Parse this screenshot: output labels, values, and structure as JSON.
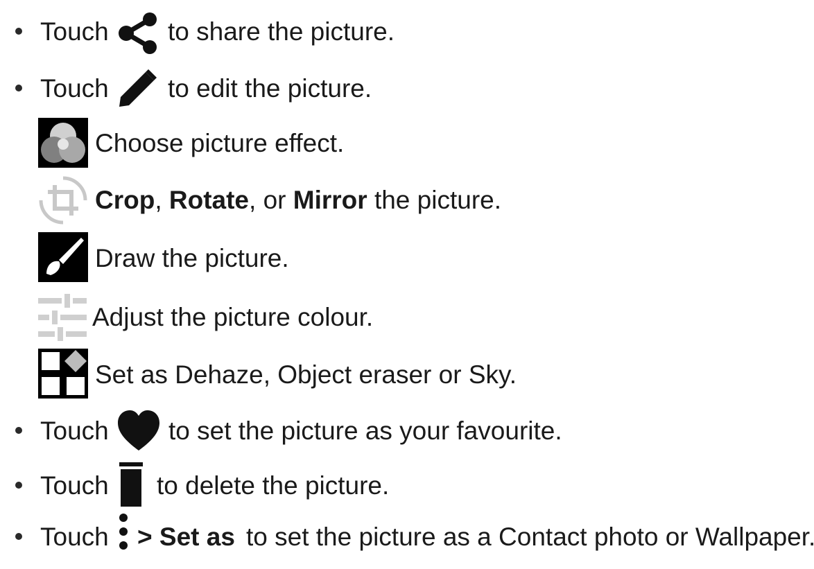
{
  "items": [
    {
      "prefix": "Touch",
      "suffix": "to share the picture.",
      "icon": "share-icon"
    },
    {
      "prefix": "Touch",
      "suffix": "to edit the picture.",
      "icon": "pencil-icon"
    },
    {
      "text": "Choose picture effect.",
      "icon": "effects-icon"
    },
    {
      "bold1": "Crop",
      "sep1": ", ",
      "bold2": "Rotate",
      "sep2": ", or ",
      "bold3": "Mirror",
      "suffix": " the picture.",
      "icon": "crop-rotate-icon"
    },
    {
      "text": "Draw the picture.",
      "icon": "brush-icon"
    },
    {
      "text": "Adjust the picture colour.",
      "icon": "sliders-icon"
    },
    {
      "text": "Set as Dehaze, Object eraser or Sky.",
      "icon": "grid-icon"
    },
    {
      "prefix": "Touch",
      "suffix": "to set the picture as your favourite.",
      "icon": "heart-icon"
    },
    {
      "prefix": "Touch",
      "suffix": "to delete the picture.",
      "icon": "trash-icon"
    },
    {
      "prefix": "Touch",
      "bold": "> Set as",
      "suffix": "to set the picture as a Contact photo or Wallpaper.",
      "icon": "more-vertical-icon"
    }
  ],
  "colors": {
    "text": "#1a1a1a",
    "icon_dark": "#111111",
    "icon_gray": "#bdbdbd"
  }
}
